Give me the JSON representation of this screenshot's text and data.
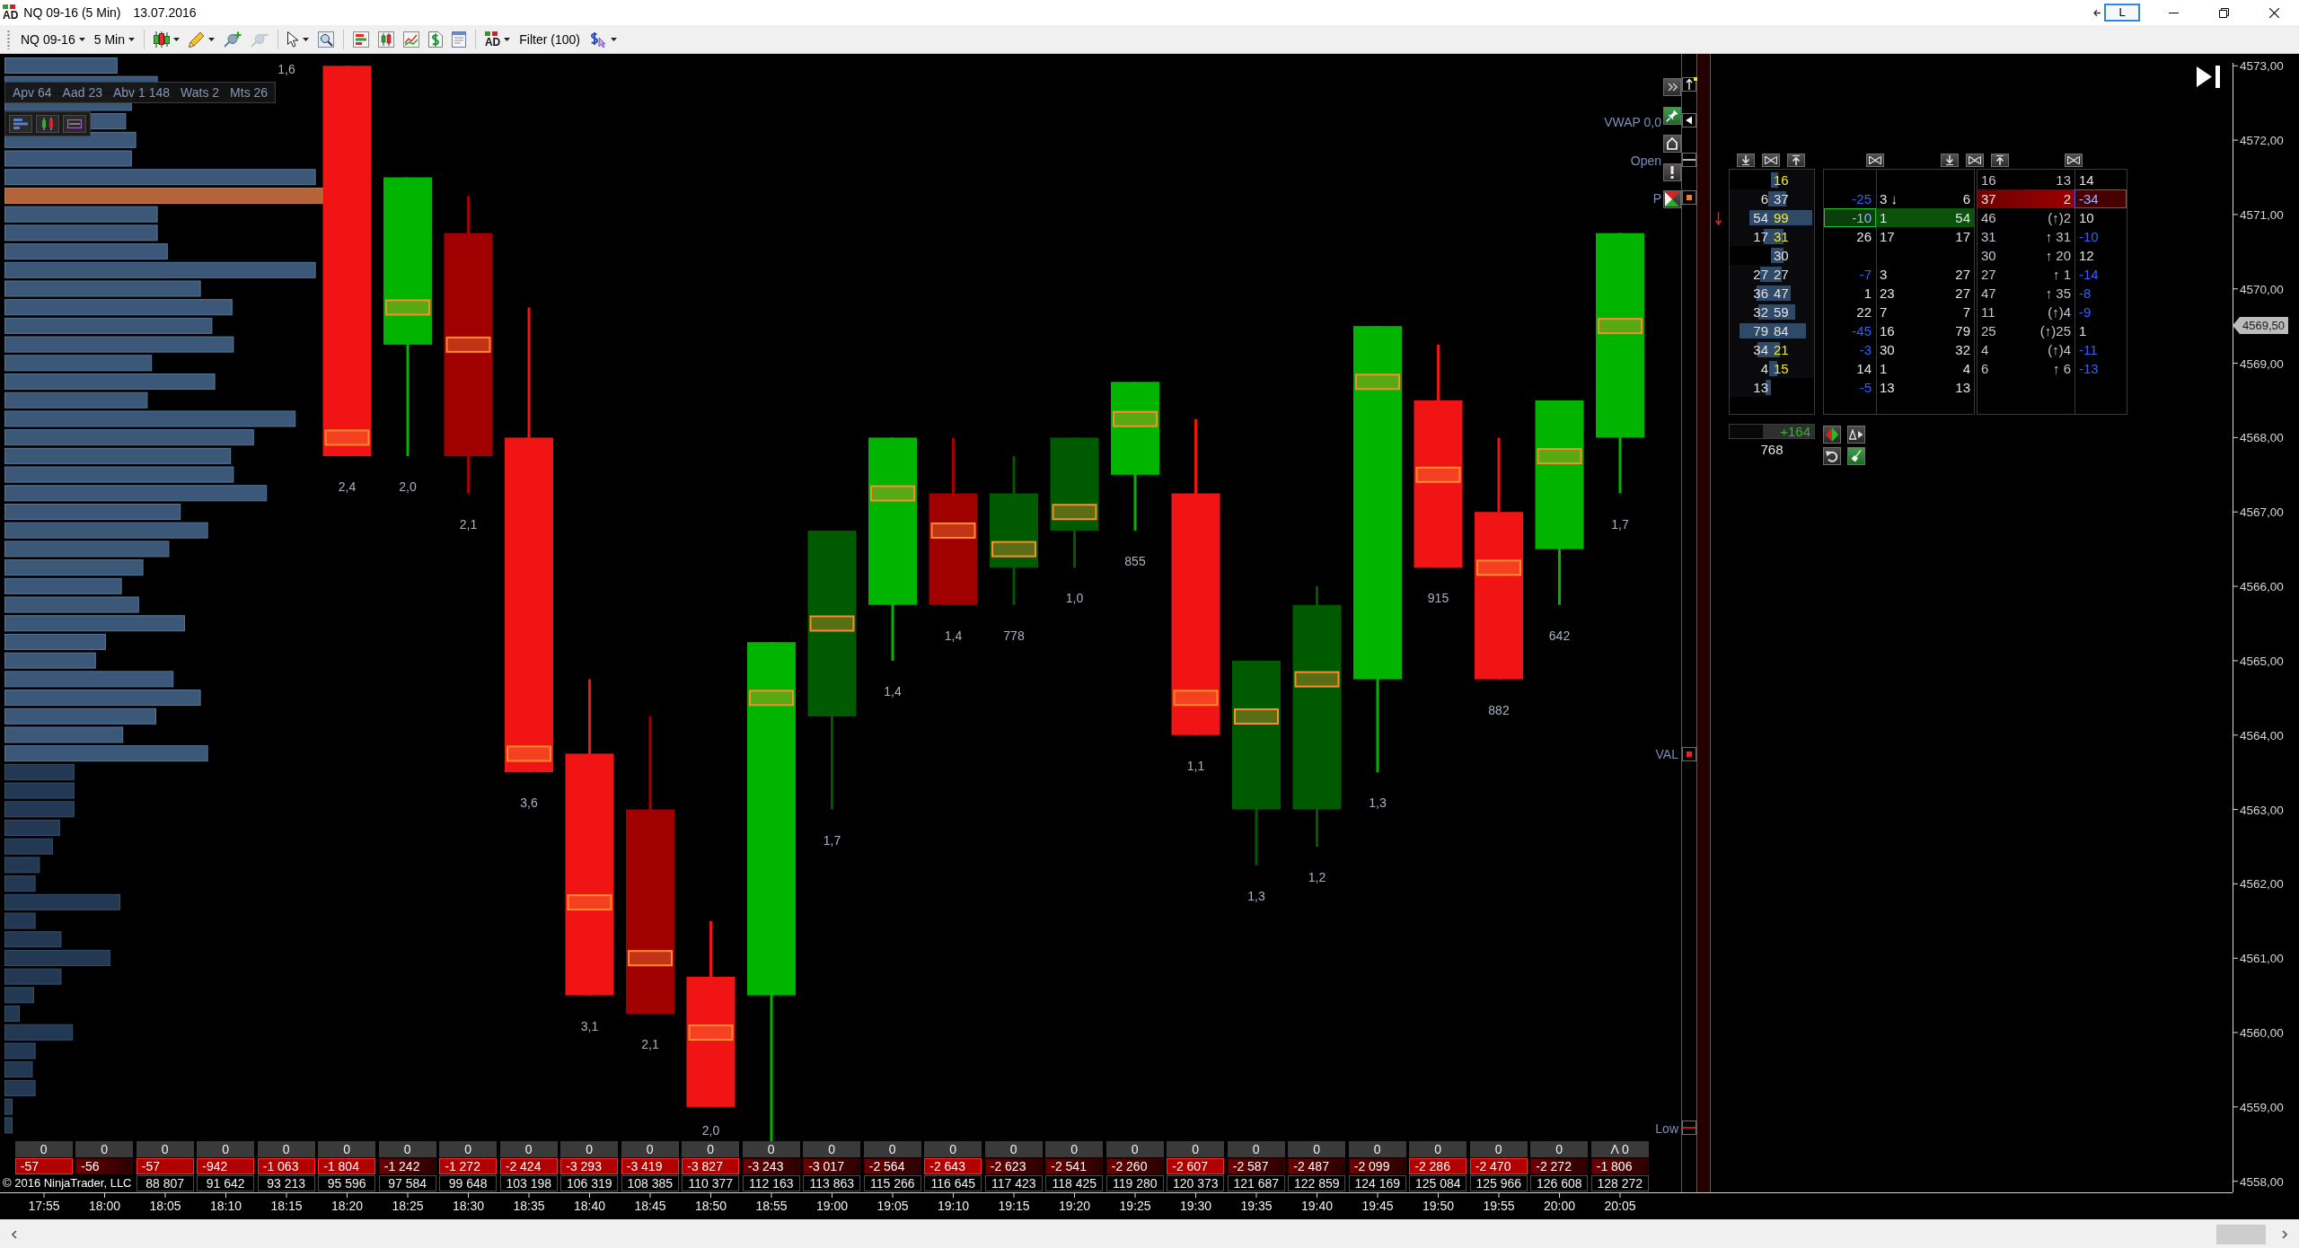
{
  "window": {
    "logo": "AD",
    "title": "NQ 09-16 (5 Min)",
    "date": "13.07.2016",
    "layout_button": "L"
  },
  "toolbar": {
    "groups": [
      [
        {
          "kind": "dropdown",
          "label": "NQ 09-16",
          "menu": true,
          "disabled": false
        },
        {
          "kind": "dropdown",
          "label": "5 Min",
          "menu": true,
          "disabled": false
        }
      ],
      [
        {
          "kind": "candles",
          "menu": true,
          "disabled": false
        },
        {
          "kind": "pencil",
          "menu": true,
          "disabled": false
        },
        {
          "kind": "pin-add",
          "menu": false,
          "disabled": false
        },
        {
          "kind": "pin-remove",
          "menu": false,
          "disabled": true
        }
      ],
      [
        {
          "kind": "pointer",
          "menu": true,
          "disabled": false
        },
        {
          "kind": "magnifier",
          "menu": false,
          "disabled": false
        }
      ],
      [
        {
          "kind": "bars",
          "menu": false,
          "disabled": false
        },
        {
          "kind": "candle-box",
          "menu": false,
          "disabled": false
        },
        {
          "kind": "line-chart",
          "menu": false,
          "disabled": false
        },
        {
          "kind": "dollar-page",
          "menu": false,
          "disabled": false
        },
        {
          "kind": "form",
          "menu": false,
          "disabled": false
        }
      ],
      [
        {
          "kind": "logo",
          "label": "AD",
          "menu": true,
          "disabled": false
        },
        {
          "kind": "text",
          "label": "Filter (100)",
          "menu": false,
          "disabled": false
        },
        {
          "kind": "dollar-cursor",
          "menu": true,
          "disabled": false
        }
      ]
    ]
  },
  "chart": {
    "indicator_stats": [
      "Apv 64",
      "Aad 23",
      "Abv 1 148",
      "Wats 2",
      "Mts 26"
    ],
    "candles": [
      {
        "kind": "hidden",
        "label": "1,6"
      },
      {
        "kind": "candle",
        "color": "#f01414",
        "label": "2,4"
      },
      {
        "kind": "candle",
        "color": "#00b400",
        "label": "2,0"
      },
      {
        "kind": "candle",
        "color": "#a00000",
        "label": "2,1"
      },
      {
        "kind": "candle",
        "color": "#f01414",
        "label": "3,6"
      },
      {
        "kind": "candle",
        "color": "#f01414",
        "label": "3,1"
      },
      {
        "kind": "candle",
        "color": "#a00000",
        "label": "2,1"
      },
      {
        "kind": "candle",
        "color": "#f01414",
        "label": "2,0"
      },
      {
        "kind": "candle",
        "color": "#00b400"
      },
      {
        "kind": "candle",
        "color": "#005a00",
        "label": "1,7"
      },
      {
        "kind": "candle",
        "color": "#00b400",
        "label": "1,4"
      },
      {
        "kind": "candle",
        "color": "#a00000",
        "label": "1,4"
      },
      {
        "kind": "candle",
        "color": "#005a00",
        "label": "778"
      },
      {
        "kind": "candle",
        "color": "#005a00",
        "label": "1,0"
      },
      {
        "kind": "candle",
        "color": "#00b400",
        "label": "855"
      },
      {
        "kind": "candle",
        "color": "#f01414",
        "label": "1,1"
      },
      {
        "kind": "candle",
        "color": "#005a00",
        "label": "1,3"
      },
      {
        "kind": "candle",
        "color": "#005a00",
        "label": "1,2"
      },
      {
        "kind": "candle",
        "color": "#00b400",
        "label": "1,3"
      },
      {
        "kind": "candle",
        "color": "#f01414",
        "label": "915"
      },
      {
        "kind": "candle",
        "color": "#f01414",
        "label": "882"
      },
      {
        "kind": "candle",
        "color": "#00b400",
        "label": "642"
      },
      {
        "kind": "candle",
        "color": "#00b400",
        "label": "1,7"
      }
    ],
    "time_axis": [
      "17:55",
      "18:00",
      "18:05",
      "18:10",
      "18:15",
      "18:20",
      "18:25",
      "18:30",
      "18:35",
      "18:40",
      "18:45",
      "18:50",
      "18:55",
      "19:00",
      "19:05",
      "19:10",
      "19:15",
      "19:20",
      "19:25",
      "19:30",
      "19:35",
      "19:40",
      "19:45",
      "19:50",
      "19:55",
      "20:00",
      "20:05"
    ],
    "price_axis": [
      "4573,00",
      "4572,00",
      "4571,00",
      "4570,00",
      "4569,00",
      "4568,00",
      "4567,00",
      "4566,00",
      "4565,00",
      "4564,00",
      "4563,00",
      "4562,00",
      "4561,00",
      "4560,00",
      "4559,00",
      "4558,00"
    ],
    "levels": [
      {
        "kind": "vwap",
        "label": "VWAP 0,0"
      },
      {
        "kind": "open",
        "label": "Open"
      },
      {
        "kind": "poc",
        "label": "P"
      },
      {
        "kind": "val",
        "label": "VAL"
      },
      {
        "kind": "low",
        "label": "Low"
      }
    ],
    "price_tag": "4569,50",
    "bar_stats": [
      {
        "volume": "0",
        "delta": "-57",
        "highlighted": true
      },
      {
        "volume": "0",
        "delta": "-56",
        "highlighted": false
      },
      {
        "volume": "0",
        "delta": "-57",
        "highlighted": true,
        "total": "88 807"
      },
      {
        "volume": "0",
        "delta": "-942",
        "highlighted": true,
        "total": "91 642"
      },
      {
        "volume": "0",
        "delta": "-1 063",
        "highlighted": true,
        "total": "93 213"
      },
      {
        "volume": "0",
        "delta": "-1 804",
        "highlighted": true,
        "total": "95 596"
      },
      {
        "volume": "0",
        "delta": "-1 242",
        "highlighted": false,
        "total": "97 584"
      },
      {
        "volume": "0",
        "delta": "-1 272",
        "highlighted": true,
        "total": "99 648"
      },
      {
        "volume": "0",
        "delta": "-2 424",
        "highlighted": true,
        "total": "103 198"
      },
      {
        "volume": "0",
        "delta": "-3 293",
        "highlighted": true,
        "total": "106 319"
      },
      {
        "volume": "0",
        "delta": "-3 419",
        "highlighted": true,
        "total": "108 385"
      },
      {
        "volume": "0",
        "delta": "-3 827",
        "highlighted": true,
        "total": "110 377"
      },
      {
        "volume": "0",
        "delta": "-3 243",
        "highlighted": false,
        "total": "112 163"
      },
      {
        "volume": "0",
        "delta": "-3 017",
        "highlighted": false,
        "total": "113 863"
      },
      {
        "volume": "0",
        "delta": "-2 564",
        "highlighted": false,
        "total": "115 266"
      },
      {
        "volume": "0",
        "delta": "-2 643",
        "highlighted": true,
        "total": "116 645"
      },
      {
        "volume": "0",
        "delta": "-2 623",
        "highlighted": false,
        "total": "117 423"
      },
      {
        "volume": "0",
        "delta": "-2 541",
        "highlighted": false,
        "total": "118 425"
      },
      {
        "volume": "0",
        "delta": "-2 260",
        "highlighted": false,
        "total": "119 280"
      },
      {
        "volume": "0",
        "delta": "-2 607",
        "highlighted": true,
        "total": "120 373"
      },
      {
        "volume": "0",
        "delta": "-2 587",
        "highlighted": false,
        "total": "121 687"
      },
      {
        "volume": "0",
        "delta": "-2 487",
        "highlighted": false,
        "total": "122 859"
      },
      {
        "volume": "0",
        "delta": "-2 099",
        "highlighted": false,
        "total": "124 169"
      },
      {
        "volume": "0",
        "delta": "-2 286",
        "highlighted": true,
        "total": "125 084"
      },
      {
        "volume": "0",
        "delta": "-2 470",
        "highlighted": true,
        "total": "125 966"
      },
      {
        "volume": "0",
        "delta": "-2 272",
        "highlighted": false,
        "total": "126 608"
      },
      {
        "volume": "Λ 0",
        "delta": "-1 806",
        "highlighted": false,
        "total": "128 272"
      }
    ],
    "copyright": "© 2016 NinjaTrader, LLC"
  },
  "dom": {
    "rows": [
      {
        "kind": "plain",
        "column_2": {
          "value": "16",
          "level": 0.16,
          "highlighted": true
        },
        "column_6": "16",
        "column_7": "13",
        "column_8": {
          "value": "14",
          "negative": false
        }
      },
      {
        "kind": "redband",
        "column_1": {
          "value": "6",
          "level": 0.06
        },
        "column_2": {
          "value": "37",
          "level": 0.36,
          "highlighted": false
        },
        "column_3": {
          "value": "-25",
          "negative": true
        },
        "column_4": "3 ↓",
        "column_5": "6",
        "column_6": "37",
        "column_7": "2",
        "column_8": {
          "value": "-34",
          "negative": true
        }
      },
      {
        "kind": "greenband",
        "column_1": {
          "value": "54",
          "level": 0.52
        },
        "column_2": {
          "value": "99",
          "level": 0.96,
          "highlighted": true
        },
        "column_3": {
          "value": "-10",
          "negative": true
        },
        "column_4": "1",
        "column_5": "54",
        "column_6": "46",
        "column_7": "(↑)2",
        "column_8": {
          "value": "10",
          "negative": false
        }
      },
      {
        "kind": "plain",
        "column_1": {
          "value": "17",
          "level": 0.17
        },
        "column_2": {
          "value": "31",
          "level": 0.3,
          "highlighted": true
        },
        "column_3": {
          "value": "26",
          "negative": false
        },
        "column_4": "17",
        "column_5": "17",
        "column_6": "31",
        "column_7": "↑ 31",
        "column_8": {
          "value": "-10",
          "negative": true
        }
      },
      {
        "kind": "plain",
        "column_2": {
          "value": "30",
          "level": 0.29,
          "highlighted": false
        },
        "column_6": "30",
        "column_7": "↑ 20",
        "column_8": {
          "value": "12",
          "negative": false
        }
      },
      {
        "kind": "plain",
        "column_1": {
          "value": "27",
          "level": 0.26
        },
        "column_2": {
          "value": "27",
          "level": 0.26,
          "highlighted": false
        },
        "column_3": {
          "value": "-7",
          "negative": true
        },
        "column_4": "3",
        "column_5": "27",
        "column_6": "27",
        "column_7": "↑ 1",
        "column_8": {
          "value": "-14",
          "negative": true
        }
      },
      {
        "kind": "plain",
        "column_1": {
          "value": "36",
          "level": 0.35
        },
        "column_2": {
          "value": "47",
          "level": 0.46,
          "highlighted": false
        },
        "column_3": {
          "value": "1",
          "negative": false
        },
        "column_4": "23",
        "column_5": "27",
        "column_6": "47",
        "column_7": "↑ 35",
        "column_8": {
          "value": "-8",
          "negative": true
        }
      },
      {
        "kind": "plain",
        "column_1": {
          "value": "32",
          "level": 0.31
        },
        "column_2": {
          "value": "59",
          "level": 0.57,
          "highlighted": false
        },
        "column_3": {
          "value": "22",
          "negative": false
        },
        "column_4": "7",
        "column_5": "7",
        "column_6": "11",
        "column_7": "(↑)4",
        "column_8": {
          "value": "-9",
          "negative": true
        }
      },
      {
        "kind": "plain",
        "column_1": {
          "value": "79",
          "level": 0.77
        },
        "column_2": {
          "value": "84",
          "level": 0.82,
          "highlighted": false
        },
        "column_3": {
          "value": "-45",
          "negative": true
        },
        "column_4": "16",
        "column_5": "79",
        "column_6": "25",
        "column_7": "(↑)25",
        "column_8": {
          "value": "1",
          "negative": false
        }
      },
      {
        "kind": "plain",
        "column_1": {
          "value": "34",
          "level": 0.33
        },
        "column_2": {
          "value": "21",
          "level": 0.2,
          "highlighted": true
        },
        "column_3": {
          "value": "-3",
          "negative": true
        },
        "column_4": "30",
        "column_5": "32",
        "column_6": "4",
        "column_7": "(↑)4",
        "column_8": {
          "value": "-11",
          "negative": true
        }
      },
      {
        "kind": "plain",
        "column_1": {
          "value": "4",
          "level": 0.04
        },
        "column_2": {
          "value": "15",
          "level": 0.15,
          "highlighted": true
        },
        "column_3": {
          "value": "14",
          "negative": false
        },
        "column_4": "1",
        "column_5": "4",
        "column_6": "6",
        "column_7": "↑ 6",
        "column_8": {
          "value": "-13",
          "negative": true
        }
      },
      {
        "kind": "plain",
        "column_1": {
          "value": "13",
          "level": 0.13
        },
        "column_3": {
          "value": "-5",
          "negative": true
        },
        "column_4": "13",
        "column_5": "13"
      }
    ],
    "summary": {
      "value": "+164",
      "level": 0.61,
      "total": "768"
    }
  }
}
